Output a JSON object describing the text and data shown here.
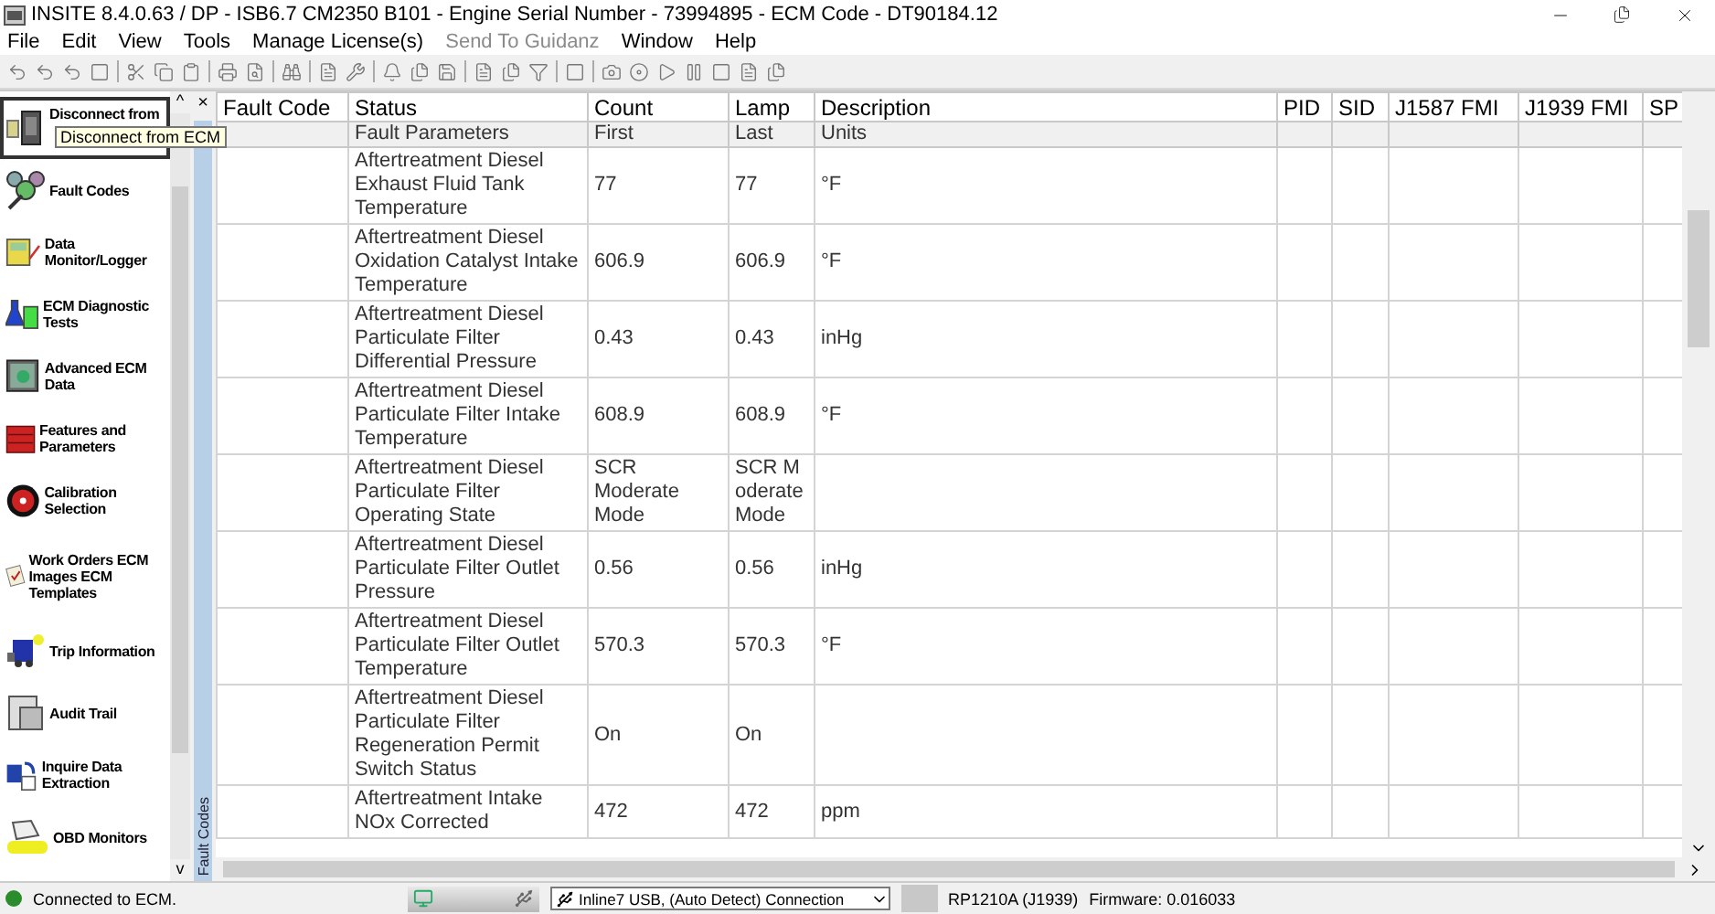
{
  "window": {
    "title": "INSITE 8.4.0.63  / DP - ISB6.7 CM2350 B101 - Engine Serial Number - 73994895 - ECM Code - DT90184.12"
  },
  "menu": [
    {
      "label": "File",
      "disabled": false
    },
    {
      "label": "Edit",
      "disabled": false
    },
    {
      "label": "View",
      "disabled": false
    },
    {
      "label": "Tools",
      "disabled": false
    },
    {
      "label": "Manage License(s)",
      "disabled": false
    },
    {
      "label": "Send To Guidanz",
      "disabled": true
    },
    {
      "label": "Window",
      "disabled": false
    },
    {
      "label": "Help",
      "disabled": false
    }
  ],
  "sidebar": {
    "items": [
      {
        "label": "Disconnect from",
        "selected": true
      },
      {
        "label": "Fault Codes",
        "selected": false
      },
      {
        "label": "Data Monitor/Logger",
        "selected": false
      },
      {
        "label": "ECM Diagnostic Tests",
        "selected": false
      },
      {
        "label": "Advanced ECM Data",
        "selected": false
      },
      {
        "label": "Features and Parameters",
        "selected": false
      },
      {
        "label": "Calibration Selection",
        "selected": false
      },
      {
        "label": "Work Orders ECM Images ECM Templates",
        "selected": false
      },
      {
        "label": "Trip Information",
        "selected": false
      },
      {
        "label": "Audit Trail",
        "selected": false
      },
      {
        "label": "Inquire Data Extraction",
        "selected": false
      },
      {
        "label": "OBD Monitors",
        "selected": false
      }
    ],
    "tooltip": "Disconnect from ECM",
    "close": "×",
    "scroll_up": "^",
    "scroll_down": "v"
  },
  "side_tab": "Fault Codes",
  "table": {
    "columns": [
      "Fault Code",
      "Status",
      "Count",
      "Lamp",
      "Description",
      "PID",
      "SID",
      "J1587 FMI",
      "J1939 FMI",
      "SP"
    ],
    "subcolumns": [
      "",
      "Fault Parameters",
      "First",
      "Last",
      "Units",
      "",
      "",
      "",
      "",
      ""
    ],
    "rows": [
      {
        "parameter": "Aftertreatment Diesel Exhaust Fluid Tank Temperature",
        "first": "77",
        "last": "77",
        "units": "°F"
      },
      {
        "parameter": "Aftertreatment Diesel Oxidation Catalyst Intake Temperature",
        "first": "606.9",
        "last": "606.9",
        "units": "°F"
      },
      {
        "parameter": "Aftertreatment Diesel Particulate Filter Differential Pressure",
        "first": "0.43",
        "last": "0.43",
        "units": "inHg"
      },
      {
        "parameter": "Aftertreatment Diesel Particulate Filter Intake Temperature",
        "first": "608.9",
        "last": "608.9",
        "units": "°F"
      },
      {
        "parameter": "Aftertreatment Diesel Particulate Filter Operating State",
        "first": "SCR Moderate Mode",
        "last": "SCR Moderate Mode"
      },
      {
        "parameter": "Aftertreatment Diesel Particulate Filter Outlet Pressure",
        "first": "0.56",
        "last": "0.56",
        "units": "inHg"
      },
      {
        "parameter": "Aftertreatment Diesel Particulate Filter Outlet Temperature",
        "first": "570.3",
        "last": "570.3",
        "units": "°F"
      },
      {
        "parameter": "Aftertreatment Diesel Particulate Filter Regeneration Permit Switch Status",
        "first": "On",
        "last": "On"
      },
      {
        "parameter": "Aftertreatment Intake NOx Corrected",
        "first": "472",
        "last": "472",
        "units": "ppm"
      }
    ]
  },
  "status_bar": {
    "connection": "Connected to ECM.",
    "adapter": "Inline7 USB, (Auto Detect) Connection",
    "protocol": "RP1210A (J1939)",
    "firmware": "Firmware: 0.016033"
  }
}
